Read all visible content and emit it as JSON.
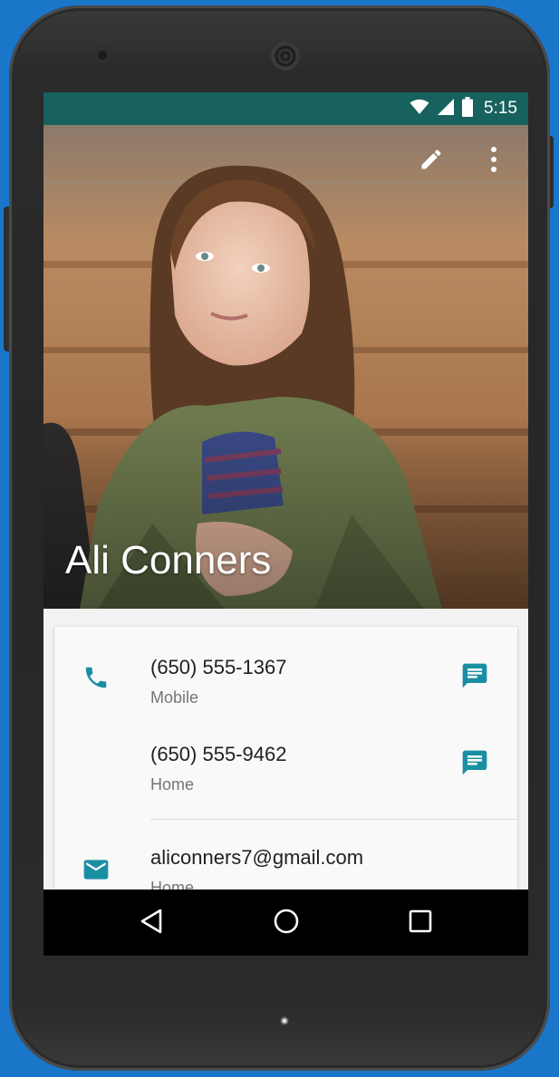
{
  "status_bar": {
    "time": "5:15",
    "icons": [
      "wifi-icon",
      "cell-signal-icon",
      "battery-icon"
    ],
    "color": "#17625f"
  },
  "toolbar": {
    "actions": [
      "edit-icon",
      "more-vert-icon"
    ]
  },
  "contact": {
    "name": "Ali Conners"
  },
  "details": {
    "phones": [
      {
        "number": "(650) 555-1367",
        "type": "Mobile",
        "action_icon": "message-icon"
      },
      {
        "number": "(650) 555-9462",
        "type": "Home",
        "action_icon": "message-icon"
      }
    ],
    "email": {
      "address": "aliconners7@gmail.com",
      "type": "Home"
    },
    "accent_color": "#1a8fa3"
  },
  "nav_bar": {
    "buttons": [
      "back-icon",
      "home-icon",
      "recents-icon"
    ]
  }
}
